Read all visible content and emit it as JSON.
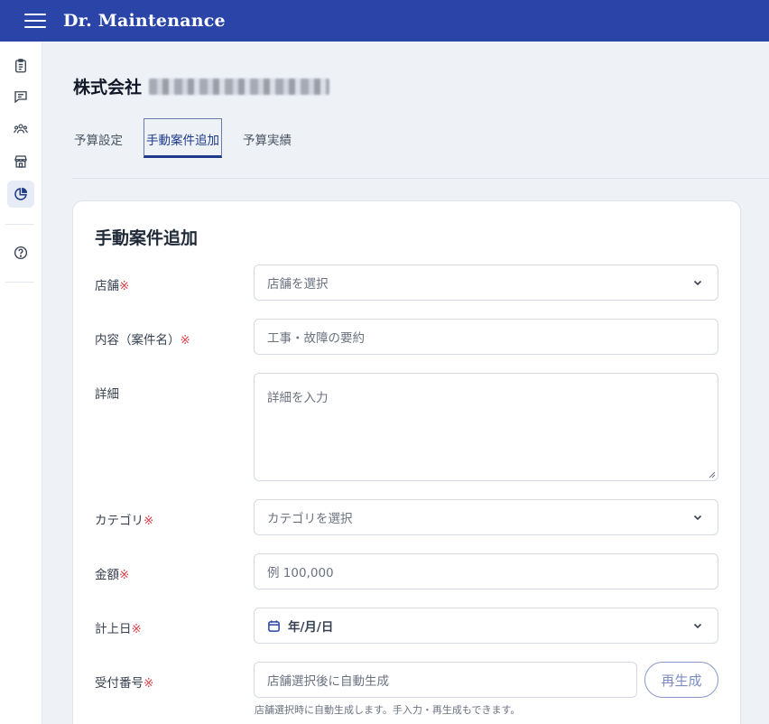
{
  "app": {
    "brand": "Dr. Maintenance"
  },
  "company": {
    "name": "株式会社"
  },
  "tabs": [
    {
      "label": "予算設定",
      "active": false
    },
    {
      "label": "手動案件追加",
      "active": true
    },
    {
      "label": "予算実績",
      "active": false
    }
  ],
  "form": {
    "title": "手動案件追加",
    "required_mark": "※",
    "store": {
      "label": "店舗",
      "placeholder": "店舗を選択"
    },
    "content": {
      "label": "内容（案件名）",
      "placeholder": "工事・故障の要約"
    },
    "detail": {
      "label": "詳細",
      "placeholder": "詳細を入力"
    },
    "category": {
      "label": "カテゴリ",
      "placeholder": "カテゴリを選択"
    },
    "amount": {
      "label": "金額",
      "placeholder": "例 100,000"
    },
    "date": {
      "label": "計上日",
      "value": "年/月/日"
    },
    "receipt": {
      "label": "受付番号",
      "placeholder": "店舗選択後に自動生成",
      "regen_label": "再生成",
      "hint": "店舗選択時に自動生成します。手入力・再生成もできます。"
    }
  },
  "colors": {
    "header": "#2a44a8",
    "accent": "#1e3a8a",
    "required": "#d9434b"
  },
  "icons": [
    "menu-icon",
    "clipboard-icon",
    "message-icon",
    "users-icon",
    "store-icon",
    "pie-chart-icon",
    "help-icon",
    "chevron-down-icon",
    "calendar-icon"
  ]
}
